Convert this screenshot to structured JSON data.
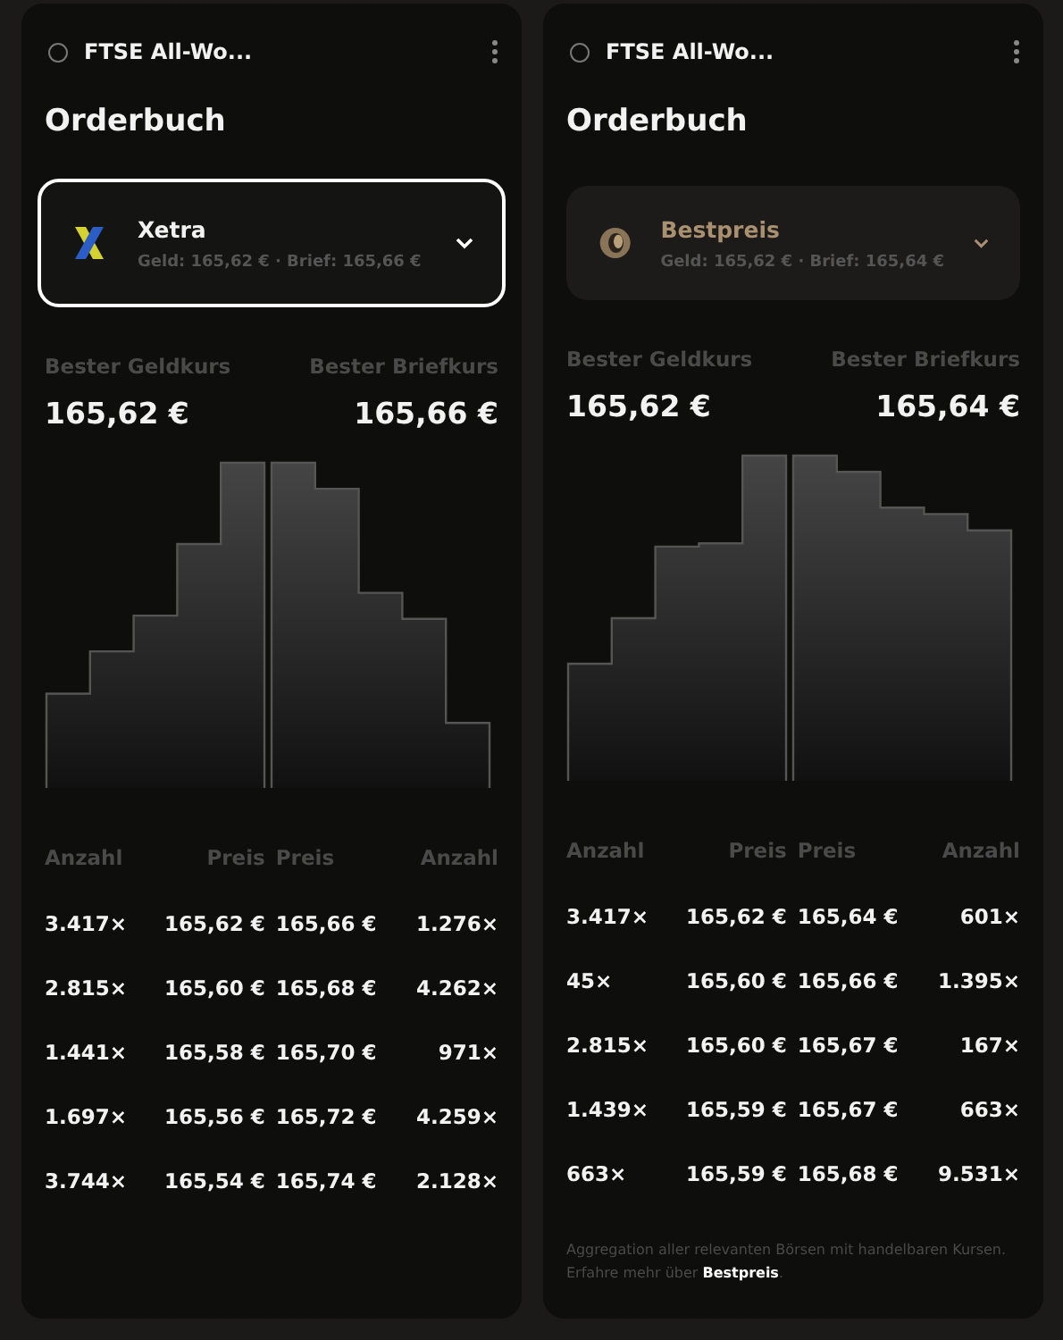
{
  "panels": [
    {
      "header": {
        "title": "FTSE All-Wo..."
      },
      "heading": "Orderbuch",
      "selector": {
        "kind": "xetra",
        "name": "Xetra",
        "detail": "Geld: 165,62 € · Brief: 165,66 €",
        "selected": true
      },
      "best": [
        {
          "label": "Bester Geldkurs",
          "value": "165,62 €"
        },
        {
          "label": "Bester Briefkurs",
          "value": "165,66 €"
        }
      ],
      "table": {
        "columns": [
          "Anzahl",
          "Preis",
          "Preis",
          "Anzahl"
        ],
        "rows": [
          [
            "3.417×",
            "165,62 €",
            "165,66 €",
            "1.276×"
          ],
          [
            "2.815×",
            "165,60 €",
            "165,68 €",
            "4.262×"
          ],
          [
            "1.441×",
            "165,58 €",
            "165,70 €",
            "971×"
          ],
          [
            "1.697×",
            "165,56 €",
            "165,72 €",
            "4.259×"
          ],
          [
            "3.744×",
            "165,54 €",
            "165,74 €",
            "2.128×"
          ]
        ]
      }
    },
    {
      "header": {
        "title": "FTSE All-Wo..."
      },
      "heading": "Orderbuch",
      "selector": {
        "kind": "bestpreis",
        "name": "Bestpreis",
        "detail": "Geld: 165,62 € · Brief: 165,64 €",
        "selected": false
      },
      "best": [
        {
          "label": "Bester Geldkurs",
          "value": "165,62 €"
        },
        {
          "label": "Bester Briefkurs",
          "value": "165,64 €"
        }
      ],
      "table": {
        "columns": [
          "Anzahl",
          "Preis",
          "Preis",
          "Anzahl"
        ],
        "rows": [
          [
            "3.417×",
            "165,62 €",
            "165,64 €",
            "601×"
          ],
          [
            "45×",
            "165,60 €",
            "165,66 €",
            "1.395×"
          ],
          [
            "2.815×",
            "165,60 €",
            "165,67 €",
            "167×"
          ],
          [
            "1.439×",
            "165,59 €",
            "165,67 €",
            "663×"
          ],
          [
            "663×",
            "165,59 €",
            "165,68 €",
            "9.531×"
          ]
        ]
      },
      "footnote": {
        "text": "Aggregation aller relevanten Börsen mit handelbaren Kursen. Erfahre mehr über",
        "link": "Bestpreis",
        "end": "."
      }
    }
  ]
}
